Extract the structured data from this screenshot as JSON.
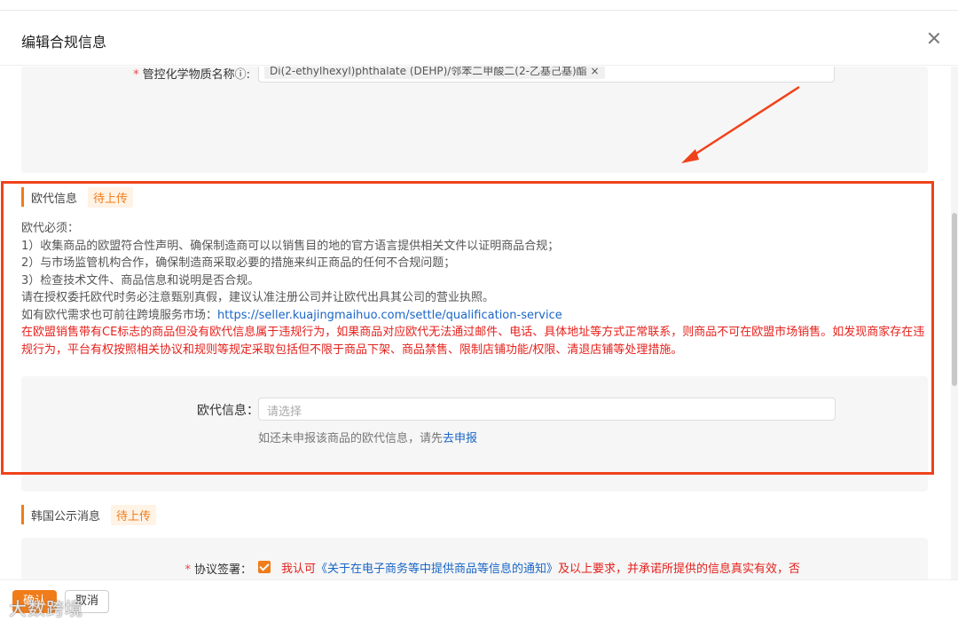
{
  "modal": {
    "title": "编辑合规信息"
  },
  "chemical": {
    "label": "管控化学物质名称",
    "required_mark": "*",
    "tag": "Di(2-ethylhexyl)phthalate (DEHP)/邻苯二甲酸二(2-乙基己基)酯 ×"
  },
  "ec_rep": {
    "section_title": "欧代信息",
    "status": "待上传",
    "lines": [
      "欧代必须：",
      "1）收集商品的欧盟符合性声明、确保制造商可以以销售目的地的官方语言提供相关文件以证明商品合规；",
      "2）与市场监管机构合作，确保制造商采取必要的措施来纠正商品的任何不合规问题；",
      "3）检查技术文件、商品信息和说明是否合规。",
      "请在授权委托欧代时务必注意甄别真假，建议认准注册公司并让欧代出具其公司的营业执照。"
    ],
    "market_prefix": "如有欧代需求也可前往跨境服务市场：",
    "market_link": "https://seller.kuajingmaihuo.com/settle/qualification-service",
    "warning": "在欧盟销售带有CE标志的商品但没有欧代信息属于违规行为，如果商品对应欧代无法通过邮件、电话、具体地址等方式正常联系，则商品不可在欧盟市场销售。如发现商家存在违规行为，平台有权按照相关协议和规则等规定采取包括但不限于商品下架、商品禁售、限制店铺功能/权限、清退店铺等处理措施。",
    "field_label": "欧代信息：",
    "placeholder": "请选择",
    "hint_prefix": "如还未申报该商品的欧代信息，请先",
    "hint_link": "去申报"
  },
  "korea": {
    "section_title": "韩国公示消息",
    "status": "待上传",
    "agreement_label": "协议签署：",
    "required_mark": "*",
    "agree_prefix": "我认可",
    "agree_doc": "《关于在电子商务等中提供商品等信息的通知》",
    "agree_suffix": "及以上要求，并承诺所提供的信息真实有效，否"
  },
  "footer": {
    "confirm": "确认",
    "cancel": "取消",
    "watermark": "大数跨境"
  },
  "colors": {
    "accent": "#f07c1a",
    "link": "#1a66c6",
    "warning": "#e5211c",
    "highlight_frame": "#f0421a"
  }
}
